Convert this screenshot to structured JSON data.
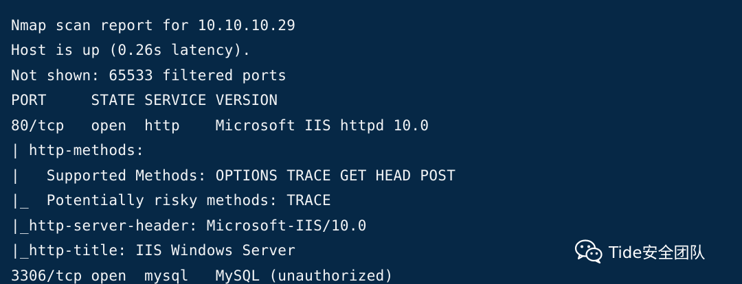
{
  "terminal": {
    "lines": [
      "",
      "Nmap scan report for 10.10.10.29",
      "Host is up (0.26s latency).",
      "Not shown: 65533 filtered ports",
      "PORT     STATE SERVICE VERSION",
      "80/tcp   open  http    Microsoft IIS httpd 10.0",
      "| http-methods:",
      "|   Supported Methods: OPTIONS TRACE GET HEAD POST",
      "|_  Potentially risky methods: TRACE",
      "|_http-server-header: Microsoft-IIS/10.0",
      "|_http-title: IIS Windows Server",
      "3306/tcp open  mysql   MySQL (unauthorized)"
    ]
  },
  "watermark": {
    "icon": "wechat-icon",
    "text": "Tide安全团队"
  },
  "colors": {
    "background": "#062846",
    "text": "#f2f4f6"
  }
}
